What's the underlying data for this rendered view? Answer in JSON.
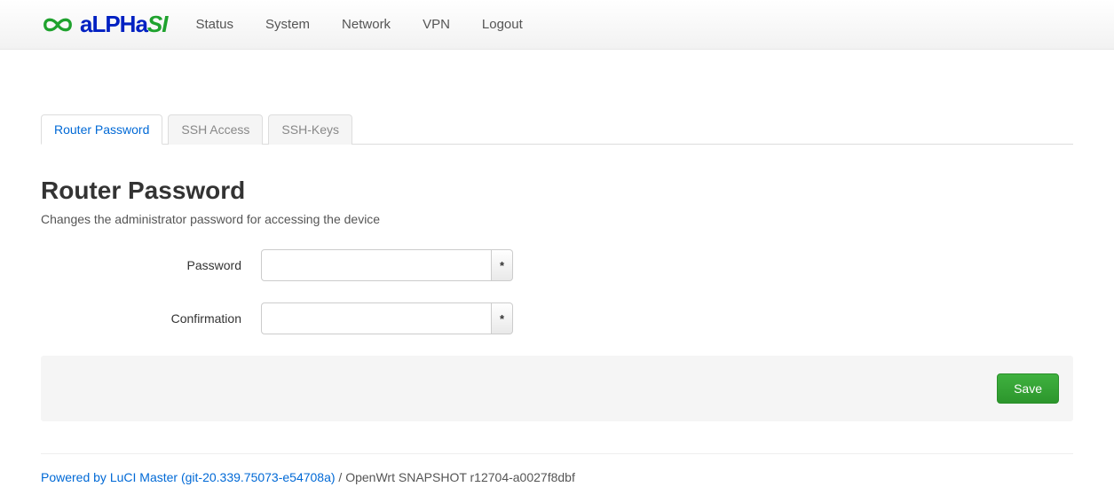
{
  "nav": {
    "items": [
      "Status",
      "System",
      "Network",
      "VPN",
      "Logout"
    ]
  },
  "tabs": [
    {
      "label": "Router Password",
      "active": true
    },
    {
      "label": "SSH Access",
      "active": false
    },
    {
      "label": "SSH-Keys",
      "active": false
    }
  ],
  "page": {
    "title": "Router Password",
    "description": "Changes the administrator password for accessing the device"
  },
  "form": {
    "password_label": "Password",
    "confirmation_label": "Confirmation",
    "reveal_char": "*"
  },
  "actions": {
    "save": "Save"
  },
  "footer": {
    "link_text": "Powered by LuCI Master (git-20.339.75073-e54708a)",
    "separator": " / ",
    "version": "OpenWrt SNAPSHOT r12704-a0027f8dbf"
  }
}
